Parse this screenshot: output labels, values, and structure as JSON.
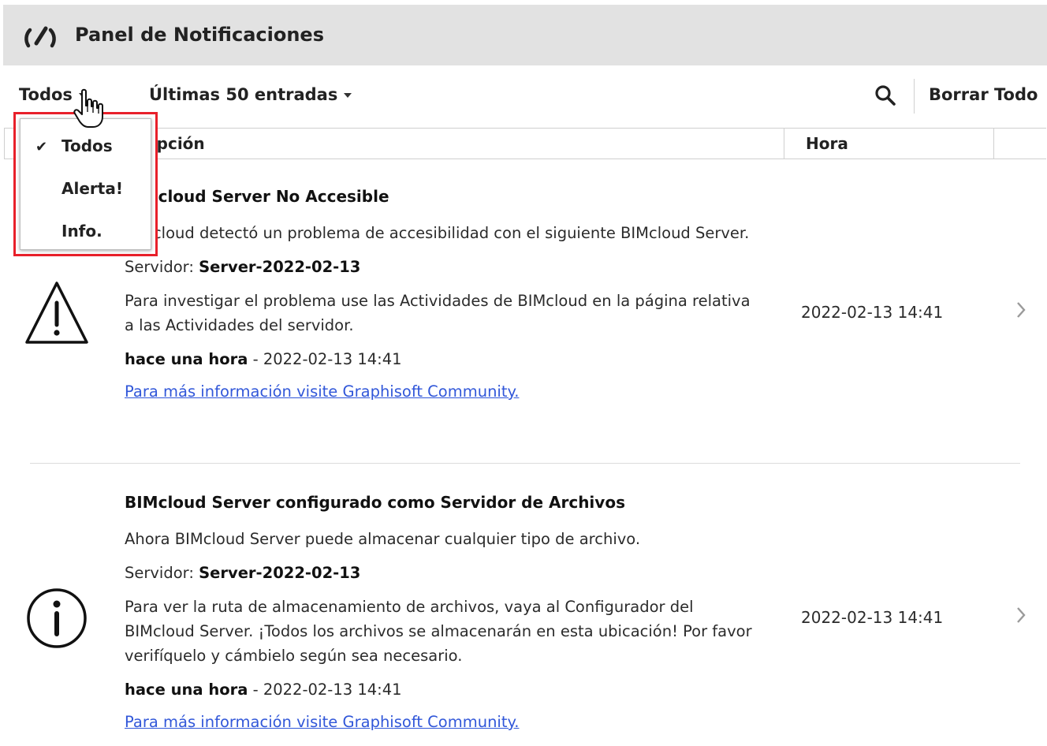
{
  "header": {
    "title": "Panel de Notificaciones",
    "logo_icon": "gauge-icon"
  },
  "toolbar": {
    "filter_label": "Todos",
    "entries_label": "Últimas 50 entradas",
    "search_icon": "search-icon",
    "clear_all_label": "Borrar Todo"
  },
  "columns": {
    "description": "Descripción",
    "time": "Hora"
  },
  "filter_menu": {
    "items": [
      {
        "label": "Todos",
        "checked": true
      },
      {
        "label": "Alerta!",
        "checked": false
      },
      {
        "label": "Info.",
        "checked": false
      }
    ]
  },
  "notifications": [
    {
      "icon": "warning-icon",
      "title": "BIMcloud Server No Accesible",
      "message": "BIMcloud detectó un problema de accesibilidad con el siguiente BIMcloud Server.",
      "server_label": "Servidor:",
      "server_value": "Server-2022-02-13",
      "detail": "Para investigar el problema use las Actividades de BIMcloud en la página relativa a las Actividades del servidor.",
      "relative_time": "hace una hora",
      "timestamp_suffix": " - 2022-02-13 14:41",
      "link": "Para más información visite Graphisoft Community.",
      "time": "2022-02-13 14:41"
    },
    {
      "icon": "info-icon",
      "title": "BIMcloud Server configurado como Servidor de Archivos",
      "message": "Ahora BIMcloud Server puede almacenar cualquier tipo de archivo.",
      "server_label": "Servidor:",
      "server_value": "Server-2022-02-13",
      "detail": "Para ver la ruta de almacenamiento de archivos, vaya al Configurador del BIMcloud Server. ¡Todos los archivos se almacenarán en esta ubicación! Por favor verifíquelo y cámbielo según sea necesario.",
      "relative_time": "hace una hora",
      "timestamp_suffix": " - 2022-02-13 14:41",
      "link": "Para más información visite Graphisoft Community.",
      "time": "2022-02-13 14:41"
    }
  ]
}
